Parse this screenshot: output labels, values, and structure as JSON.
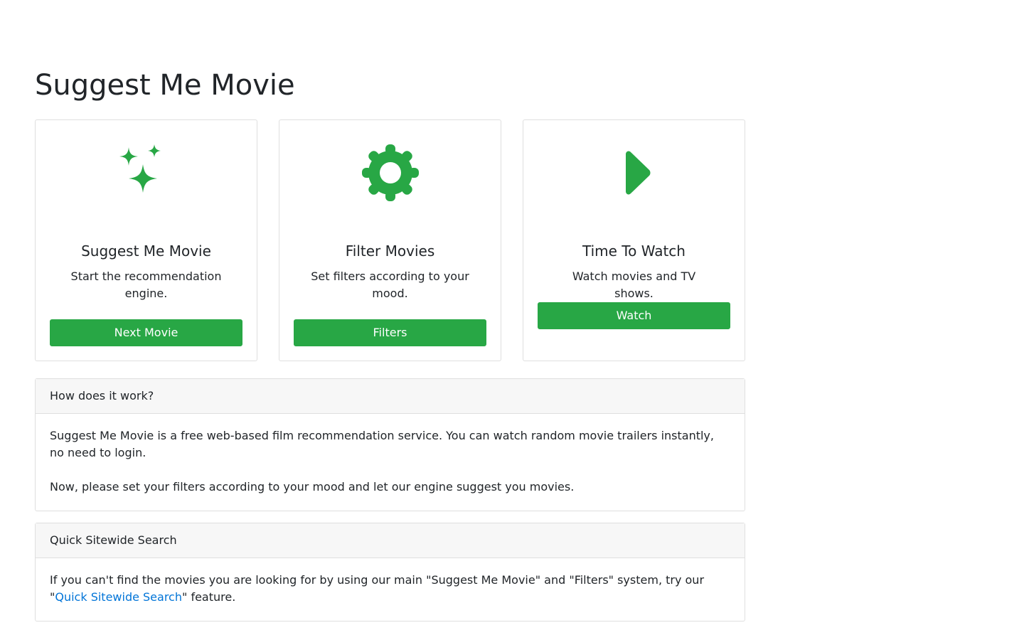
{
  "page": {
    "title": "Suggest Me Movie"
  },
  "colors": {
    "accent": "#28a745",
    "link": "#0275d8",
    "border": "#dfdfdf",
    "panel_header_bg": "#f7f7f7"
  },
  "cards": [
    {
      "icon": "sparkles-icon",
      "title": "Suggest Me Movie",
      "text": "Start the recommendation engine.",
      "button_label": "Next Movie"
    },
    {
      "icon": "gear-icon",
      "title": "Filter Movies",
      "text": "Set filters according to your mood.",
      "button_label": "Filters"
    },
    {
      "icon": "play-icon",
      "title": "Time To Watch",
      "text": "Watch movies and TV shows.",
      "button_label": "Watch"
    }
  ],
  "how_it_works": {
    "header": "How does it work?",
    "paragraph_1": "Suggest Me Movie is a free web-based film recommendation service. You can watch random movie trailers instantly, no need to login.",
    "paragraph_2": "Now, please set your filters according to your mood and let our engine suggest you movies."
  },
  "quick_search": {
    "header": "Quick Sitewide Search",
    "text_before": "If you can't find the movies you are looking for by using our main \"Suggest Me Movie\" and \"Filters\" system, try our \"",
    "link_label": "Quick Sitewide Search",
    "text_after": "\" feature."
  }
}
